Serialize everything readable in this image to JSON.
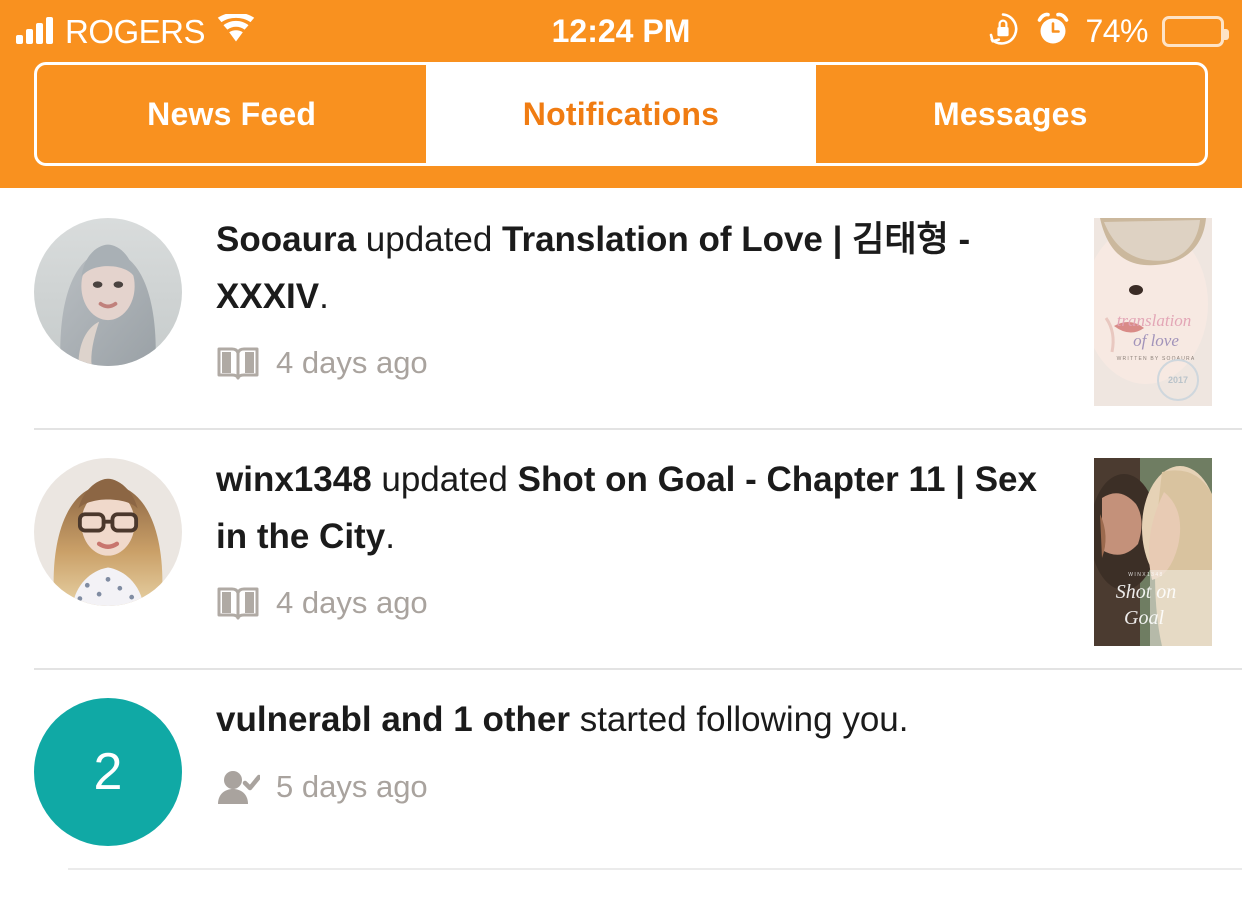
{
  "status_bar": {
    "carrier": "ROGERS",
    "signal_icon": "signal-bars-icon",
    "wifi_icon": "wifi-icon",
    "time": "12:24 PM",
    "rotation_lock_icon": "rotation-lock-icon",
    "alarm_icon": "alarm-clock-icon",
    "battery_percent": "74%",
    "battery_icon": "battery-icon",
    "background_color": "#F9911F",
    "text_color": "#FFFFFF"
  },
  "tabs": {
    "active_index": 1,
    "items": [
      {
        "label": "News Feed",
        "active": false
      },
      {
        "label": "Notifications",
        "active": true
      },
      {
        "label": "Messages",
        "active": false
      }
    ],
    "active_text_color": "#F07C12",
    "inactive_text_color": "#FFFFFF"
  },
  "notifications": [
    {
      "id": "notif-1",
      "avatar": "user-avatar-sooaura",
      "text_parts": [
        {
          "text": "Sooaura",
          "bold": true
        },
        {
          "text": " updated ",
          "bold": false
        },
        {
          "text": "Translation of Love | 김태형 - XXXIV",
          "bold": true
        },
        {
          "text": ".",
          "bold": false
        }
      ],
      "plain_text": "Sooaura updated Translation of Love | 김태형 - XXXIV.",
      "meta_icon": "book-icon",
      "time": "4 days ago",
      "thumbnail": "story-cover-translation-of-love",
      "has_thumbnail": true
    },
    {
      "id": "notif-2",
      "avatar": "user-avatar-winx1348",
      "text_parts": [
        {
          "text": "winx1348",
          "bold": true
        },
        {
          "text": " updated ",
          "bold": false
        },
        {
          "text": "Shot on Goal - Chapter 11 | Sex in the City",
          "bold": true
        },
        {
          "text": ".",
          "bold": false
        }
      ],
      "plain_text": "winx1348 updated Shot on Goal - Chapter 11 | Sex in the City.",
      "meta_icon": "book-icon",
      "time": "4 days ago",
      "thumbnail": "story-cover-shot-on-goal",
      "has_thumbnail": true
    },
    {
      "id": "notif-3",
      "avatar": "count-badge",
      "badge_count": "2",
      "badge_color": "#10A9A5",
      "text_parts": [
        {
          "text": "vulnerabl and 1 other",
          "bold": true
        },
        {
          "text": " started following you.",
          "bold": false
        }
      ],
      "plain_text": "vulnerabl and 1 other started following you.",
      "meta_icon": "user-follow-icon",
      "time": "5 days ago",
      "thumbnail": null,
      "has_thumbnail": false
    }
  ]
}
